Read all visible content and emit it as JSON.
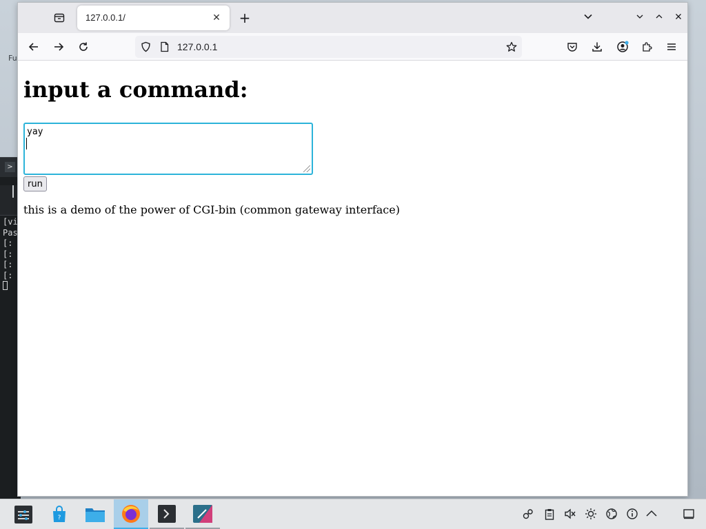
{
  "desktop": {
    "label": "Fu"
  },
  "terminal": {
    "lines": [
      "[vi",
      "Pas",
      "[:",
      "[:",
      "[:",
      "[:"
    ]
  },
  "browser": {
    "tab": {
      "title": "127.0.0.1/",
      "close_glyph": "✕"
    },
    "new_tab_glyph": "+",
    "address": {
      "url": "127.0.0.1"
    },
    "icons": {
      "tab_list": "chevron-down-icon",
      "minimize": "chevron-down-icon",
      "maximize": "chevron-up-icon",
      "close": "close-icon"
    }
  },
  "page": {
    "heading": "input a command:",
    "textarea_value": "yay",
    "run_label": "run",
    "description": "this is a demo of the power of CGI-bin (common gateway interface)"
  },
  "taskbar": {
    "tasks": [
      "app-launcher",
      "discover",
      "dolphin-files",
      "firefox",
      "konsole",
      "krita"
    ],
    "active": "firefox",
    "tray": [
      "network-icon",
      "clipboard-icon",
      "volume-muted-icon",
      "brightness-icon",
      "globe-icon",
      "help-icon",
      "tray-expand-icon",
      "show-desktop-icon"
    ]
  },
  "colors": {
    "focus_accent": "#2bb3d9",
    "taskbar_active": "#a9cfe9",
    "taskbar_indicator": "#3daee9"
  }
}
